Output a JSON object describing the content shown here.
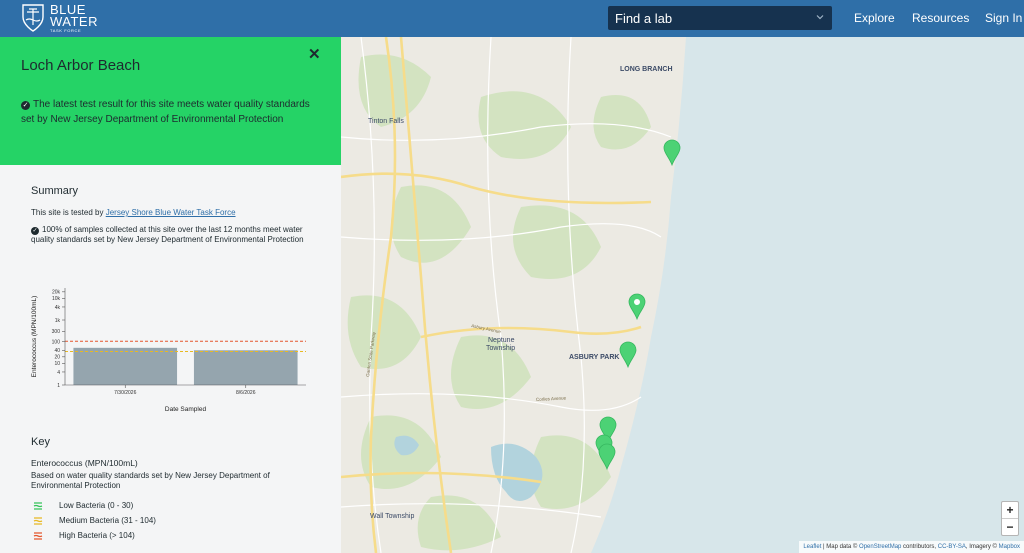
{
  "header": {
    "logo": {
      "line1": "BLUE",
      "line2": "WATER",
      "line3": "TASK FORCE"
    },
    "find_lab": {
      "label": "Find a lab"
    },
    "nav": [
      "Explore",
      "Resources",
      "Sign In"
    ]
  },
  "panel": {
    "site_name": "Loch Arbor Beach",
    "close_symbol": "✕",
    "status_message": "The latest test result for this site meets water quality standards set by New Jersey Department of Environmental Protection",
    "summary": {
      "title": "Summary",
      "tested_by_prefix": "This site is tested by ",
      "tested_by_link": "Jersey Shore Blue Water Task Force",
      "compliance_text": "100% of samples collected at this site over the last 12 months meet water quality standards set by New Jersey Department of Environmental Protection"
    },
    "key": {
      "title": "Key",
      "subtitle": "Enterococcus (MPN/100mL)",
      "note": "Based on water quality standards set by New Jersey Department of Environmental Protection",
      "items": [
        {
          "label": "Low Bacteria (0 - 30)",
          "color": "#35c35a"
        },
        {
          "label": "Medium Bacteria (31 - 104)",
          "color": "#e8b923"
        },
        {
          "label": "High Bacteria (> 104)",
          "color": "#e4572e"
        }
      ]
    }
  },
  "chart_data": {
    "type": "bar",
    "categories": [
      "7/30/2026",
      "8/6/2026"
    ],
    "values": [
      52,
      40
    ],
    "xlabel": "Date Sampled",
    "ylabel": "Enterococcus (MPN/100mL)",
    "yscale": "log",
    "yticks": [
      1,
      4,
      10,
      20,
      40,
      100,
      300,
      1000,
      4000,
      10000,
      20000
    ],
    "ytick_labels": [
      "1",
      "4",
      "10",
      "20",
      "40",
      "100",
      "300",
      "1k",
      "4k",
      "10k",
      "20k"
    ],
    "reference_lines": [
      {
        "value": 104,
        "color": "#e4572e",
        "style": "dashed"
      },
      {
        "value": 35,
        "color": "#e8b923",
        "style": "dashed"
      }
    ],
    "bar_color": "#95a5ae"
  },
  "map": {
    "place_labels": [
      "LONG BRANCH",
      "Tinton Falls",
      "Neptune Township",
      "ASBURY PARK",
      "Wall Township"
    ],
    "road_labels": [
      "Asbury Avenue",
      "Corlies Avenue",
      "Garden State Parkway"
    ],
    "zoom_in": "+",
    "zoom_out": "−",
    "attribution": {
      "leaflet": "Leaflet",
      "text1": " | Map data © ",
      "osm": "OpenStreetMap",
      "text2": " contributors, ",
      "license": "CC-BY-SA",
      "text3": ", Imagery © ",
      "mapbox": "Mapbox"
    },
    "marker_color": "#4cd275"
  }
}
